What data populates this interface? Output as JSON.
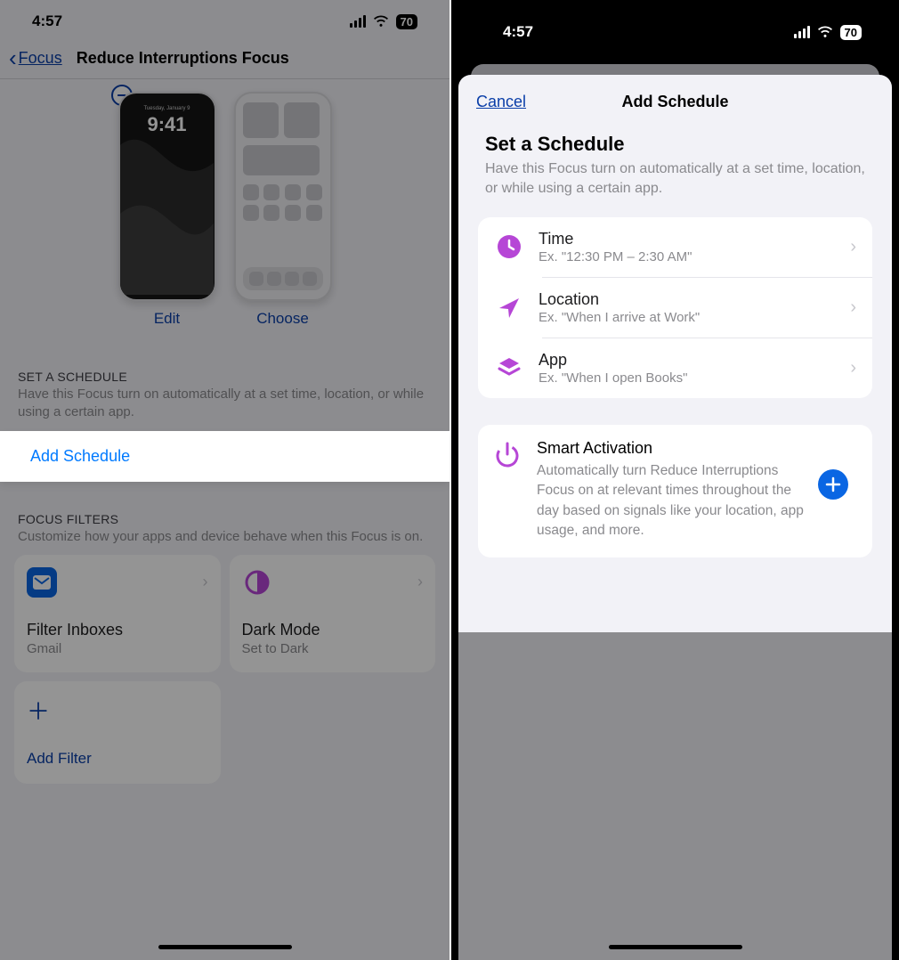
{
  "left": {
    "status": {
      "time": "4:57",
      "battery": "70"
    },
    "nav": {
      "back_label": "Focus",
      "title": "Reduce Interruptions Focus"
    },
    "lockscreen": {
      "date": "Tuesday, January 9",
      "time": "9:41"
    },
    "customize": {
      "edit": "Edit",
      "choose": "Choose"
    },
    "schedule": {
      "header": "SET A SCHEDULE",
      "sub": "Have this Focus turn on automatically at a set time, location, or while using a certain app.",
      "add": "Add Schedule"
    },
    "filters": {
      "header": "FOCUS FILTERS",
      "sub": "Customize how your apps and device behave when this Focus is on.",
      "items": [
        {
          "title": "Filter Inboxes",
          "subtitle": "Gmail",
          "icon": "mail"
        },
        {
          "title": "Dark Mode",
          "subtitle": "Set to Dark",
          "icon": "appearance"
        }
      ],
      "add": "Add Filter"
    }
  },
  "right": {
    "status": {
      "time": "4:57",
      "battery": "70"
    },
    "sheet": {
      "cancel": "Cancel",
      "title": "Add Schedule",
      "section": {
        "header": "Set a Schedule",
        "sub": "Have this Focus turn on automatically at a set time, location, or while using a certain app."
      },
      "options": [
        {
          "title": "Time",
          "subtitle": "Ex. \"12:30 PM – 2:30 AM\"",
          "icon": "clock"
        },
        {
          "title": "Location",
          "subtitle": "Ex. \"When I arrive at Work\"",
          "icon": "arrow"
        },
        {
          "title": "App",
          "subtitle": "Ex. \"When I open Books\"",
          "icon": "layers"
        }
      ],
      "smart": {
        "title": "Smart Activation",
        "subtitle": "Automatically turn Reduce Interruptions Focus on at relevant times throughout the day based on signals like your location, app usage, and more."
      }
    }
  }
}
